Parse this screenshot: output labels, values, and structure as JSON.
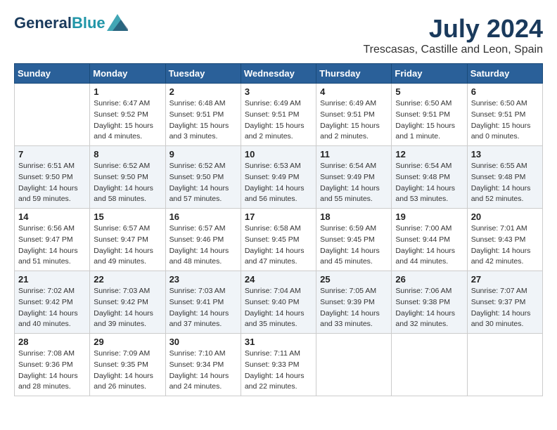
{
  "header": {
    "logo_line1": "General",
    "logo_line2": "Blue",
    "month_year": "July 2024",
    "location": "Trescasas, Castille and Leon, Spain"
  },
  "days_of_week": [
    "Sunday",
    "Monday",
    "Tuesday",
    "Wednesday",
    "Thursday",
    "Friday",
    "Saturday"
  ],
  "weeks": [
    [
      {
        "day": "",
        "sunrise": "",
        "sunset": "",
        "daylight": ""
      },
      {
        "day": "1",
        "sunrise": "Sunrise: 6:47 AM",
        "sunset": "Sunset: 9:52 PM",
        "daylight": "Daylight: 15 hours and 4 minutes."
      },
      {
        "day": "2",
        "sunrise": "Sunrise: 6:48 AM",
        "sunset": "Sunset: 9:51 PM",
        "daylight": "Daylight: 15 hours and 3 minutes."
      },
      {
        "day": "3",
        "sunrise": "Sunrise: 6:49 AM",
        "sunset": "Sunset: 9:51 PM",
        "daylight": "Daylight: 15 hours and 2 minutes."
      },
      {
        "day": "4",
        "sunrise": "Sunrise: 6:49 AM",
        "sunset": "Sunset: 9:51 PM",
        "daylight": "Daylight: 15 hours and 2 minutes."
      },
      {
        "day": "5",
        "sunrise": "Sunrise: 6:50 AM",
        "sunset": "Sunset: 9:51 PM",
        "daylight": "Daylight: 15 hours and 1 minute."
      },
      {
        "day": "6",
        "sunrise": "Sunrise: 6:50 AM",
        "sunset": "Sunset: 9:51 PM",
        "daylight": "Daylight: 15 hours and 0 minutes."
      }
    ],
    [
      {
        "day": "7",
        "sunrise": "Sunrise: 6:51 AM",
        "sunset": "Sunset: 9:50 PM",
        "daylight": "Daylight: 14 hours and 59 minutes."
      },
      {
        "day": "8",
        "sunrise": "Sunrise: 6:52 AM",
        "sunset": "Sunset: 9:50 PM",
        "daylight": "Daylight: 14 hours and 58 minutes."
      },
      {
        "day": "9",
        "sunrise": "Sunrise: 6:52 AM",
        "sunset": "Sunset: 9:50 PM",
        "daylight": "Daylight: 14 hours and 57 minutes."
      },
      {
        "day": "10",
        "sunrise": "Sunrise: 6:53 AM",
        "sunset": "Sunset: 9:49 PM",
        "daylight": "Daylight: 14 hours and 56 minutes."
      },
      {
        "day": "11",
        "sunrise": "Sunrise: 6:54 AM",
        "sunset": "Sunset: 9:49 PM",
        "daylight": "Daylight: 14 hours and 55 minutes."
      },
      {
        "day": "12",
        "sunrise": "Sunrise: 6:54 AM",
        "sunset": "Sunset: 9:48 PM",
        "daylight": "Daylight: 14 hours and 53 minutes."
      },
      {
        "day": "13",
        "sunrise": "Sunrise: 6:55 AM",
        "sunset": "Sunset: 9:48 PM",
        "daylight": "Daylight: 14 hours and 52 minutes."
      }
    ],
    [
      {
        "day": "14",
        "sunrise": "Sunrise: 6:56 AM",
        "sunset": "Sunset: 9:47 PM",
        "daylight": "Daylight: 14 hours and 51 minutes."
      },
      {
        "day": "15",
        "sunrise": "Sunrise: 6:57 AM",
        "sunset": "Sunset: 9:47 PM",
        "daylight": "Daylight: 14 hours and 49 minutes."
      },
      {
        "day": "16",
        "sunrise": "Sunrise: 6:57 AM",
        "sunset": "Sunset: 9:46 PM",
        "daylight": "Daylight: 14 hours and 48 minutes."
      },
      {
        "day": "17",
        "sunrise": "Sunrise: 6:58 AM",
        "sunset": "Sunset: 9:45 PM",
        "daylight": "Daylight: 14 hours and 47 minutes."
      },
      {
        "day": "18",
        "sunrise": "Sunrise: 6:59 AM",
        "sunset": "Sunset: 9:45 PM",
        "daylight": "Daylight: 14 hours and 45 minutes."
      },
      {
        "day": "19",
        "sunrise": "Sunrise: 7:00 AM",
        "sunset": "Sunset: 9:44 PM",
        "daylight": "Daylight: 14 hours and 44 minutes."
      },
      {
        "day": "20",
        "sunrise": "Sunrise: 7:01 AM",
        "sunset": "Sunset: 9:43 PM",
        "daylight": "Daylight: 14 hours and 42 minutes."
      }
    ],
    [
      {
        "day": "21",
        "sunrise": "Sunrise: 7:02 AM",
        "sunset": "Sunset: 9:42 PM",
        "daylight": "Daylight: 14 hours and 40 minutes."
      },
      {
        "day": "22",
        "sunrise": "Sunrise: 7:03 AM",
        "sunset": "Sunset: 9:42 PM",
        "daylight": "Daylight: 14 hours and 39 minutes."
      },
      {
        "day": "23",
        "sunrise": "Sunrise: 7:03 AM",
        "sunset": "Sunset: 9:41 PM",
        "daylight": "Daylight: 14 hours and 37 minutes."
      },
      {
        "day": "24",
        "sunrise": "Sunrise: 7:04 AM",
        "sunset": "Sunset: 9:40 PM",
        "daylight": "Daylight: 14 hours and 35 minutes."
      },
      {
        "day": "25",
        "sunrise": "Sunrise: 7:05 AM",
        "sunset": "Sunset: 9:39 PM",
        "daylight": "Daylight: 14 hours and 33 minutes."
      },
      {
        "day": "26",
        "sunrise": "Sunrise: 7:06 AM",
        "sunset": "Sunset: 9:38 PM",
        "daylight": "Daylight: 14 hours and 32 minutes."
      },
      {
        "day": "27",
        "sunrise": "Sunrise: 7:07 AM",
        "sunset": "Sunset: 9:37 PM",
        "daylight": "Daylight: 14 hours and 30 minutes."
      }
    ],
    [
      {
        "day": "28",
        "sunrise": "Sunrise: 7:08 AM",
        "sunset": "Sunset: 9:36 PM",
        "daylight": "Daylight: 14 hours and 28 minutes."
      },
      {
        "day": "29",
        "sunrise": "Sunrise: 7:09 AM",
        "sunset": "Sunset: 9:35 PM",
        "daylight": "Daylight: 14 hours and 26 minutes."
      },
      {
        "day": "30",
        "sunrise": "Sunrise: 7:10 AM",
        "sunset": "Sunset: 9:34 PM",
        "daylight": "Daylight: 14 hours and 24 minutes."
      },
      {
        "day": "31",
        "sunrise": "Sunrise: 7:11 AM",
        "sunset": "Sunset: 9:33 PM",
        "daylight": "Daylight: 14 hours and 22 minutes."
      },
      {
        "day": "",
        "sunrise": "",
        "sunset": "",
        "daylight": ""
      },
      {
        "day": "",
        "sunrise": "",
        "sunset": "",
        "daylight": ""
      },
      {
        "day": "",
        "sunrise": "",
        "sunset": "",
        "daylight": ""
      }
    ]
  ]
}
